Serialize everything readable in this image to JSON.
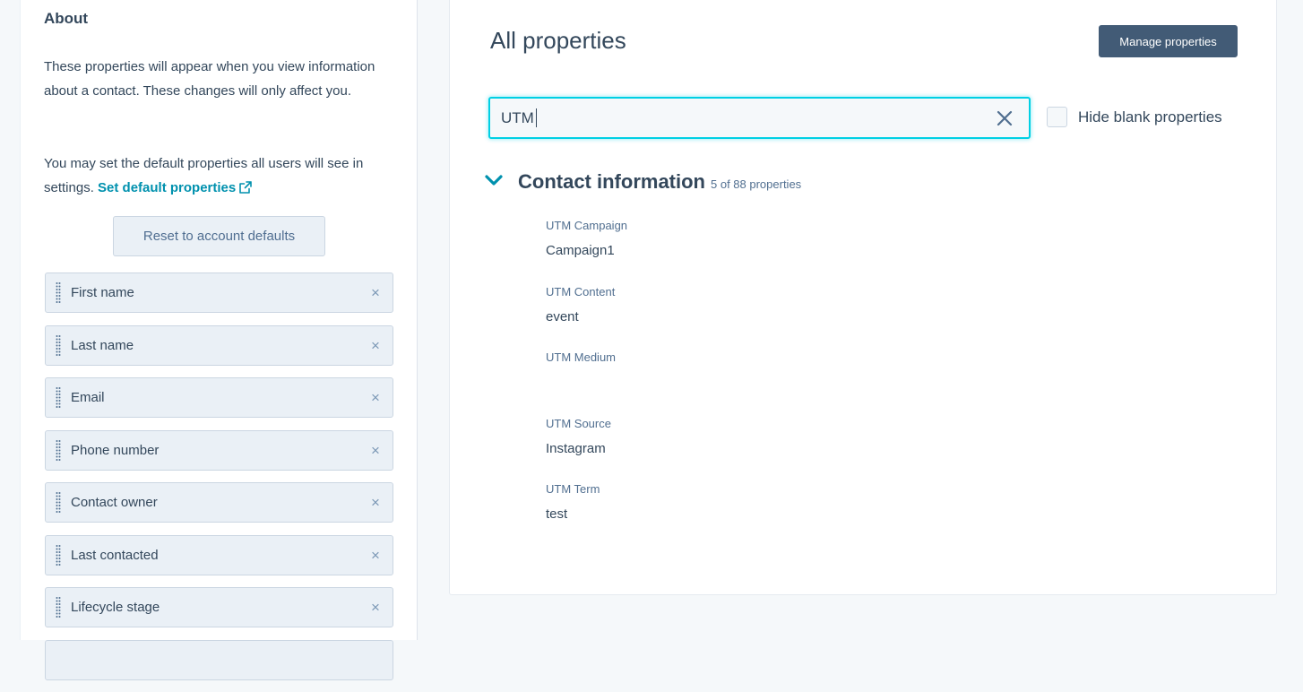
{
  "about": {
    "title": "About",
    "text1": "These properties will appear when you view information about a contact. These changes will only affect you.",
    "text2": "You may set the default properties all users will see in settings.",
    "link": "Set default properties",
    "reset_label": "Reset to account defaults"
  },
  "property_list": [
    {
      "label": "First name"
    },
    {
      "label": "Last name"
    },
    {
      "label": "Email"
    },
    {
      "label": "Phone number"
    },
    {
      "label": "Contact owner"
    },
    {
      "label": "Last contacted"
    },
    {
      "label": "Lifecycle stage"
    }
  ],
  "main": {
    "title": "All properties",
    "manage_label": "Manage properties",
    "search_value": "UTM",
    "hide_blank_label": "Hide blank properties",
    "section": {
      "title": "Contact information",
      "count": "5 of 88 properties",
      "fields": [
        {
          "label": "UTM Campaign",
          "value": "Campaign1"
        },
        {
          "label": "UTM Content",
          "value": "event"
        },
        {
          "label": "UTM Medium",
          "value": ""
        },
        {
          "label": "UTM Source",
          "value": "Instagram"
        },
        {
          "label": "UTM Term",
          "value": "test"
        }
      ]
    }
  },
  "colors": {
    "accent": "#0091ae",
    "focus": "#00d0e4",
    "primary_button": "#425b76"
  },
  "icons": {
    "external": "external-link-icon",
    "clear": "close-icon",
    "chevron": "chevron-down-icon",
    "grip": "drag-handle-icon",
    "remove": "remove-icon"
  }
}
